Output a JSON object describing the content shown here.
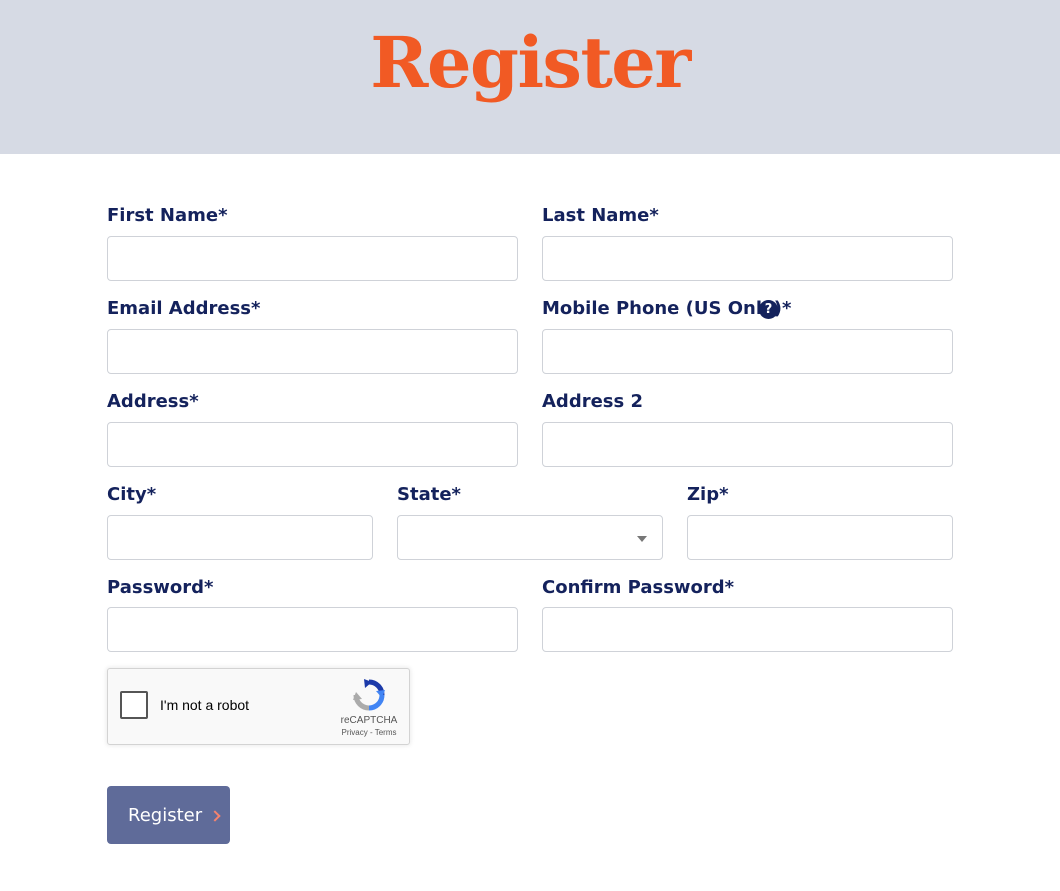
{
  "header": {
    "title": "Register"
  },
  "form": {
    "first_name": {
      "label": "First Name*",
      "value": "",
      "placeholder": ""
    },
    "last_name": {
      "label": "Last Name*",
      "value": "",
      "placeholder": ""
    },
    "email": {
      "label": "Email Address*",
      "value": "",
      "placeholder": ""
    },
    "mobile_phone": {
      "label": "Mobile Phone (US Only)*",
      "value": "",
      "placeholder": "",
      "help_icon": "question-circle-icon",
      "help_glyph": "?"
    },
    "address": {
      "label": "Address*",
      "value": "",
      "placeholder": ""
    },
    "address2": {
      "label": "Address 2",
      "value": "",
      "placeholder": ""
    },
    "city": {
      "label": "City*",
      "value": "",
      "placeholder": ""
    },
    "state": {
      "label": "State*",
      "selected": ""
    },
    "zip": {
      "label": "Zip*",
      "value": "",
      "placeholder": ""
    },
    "password": {
      "label": "Password*",
      "value": "",
      "placeholder": ""
    },
    "confirm_password": {
      "label": "Confirm Password*",
      "value": "",
      "placeholder": ""
    }
  },
  "captcha": {
    "label": "I'm not a robot",
    "brand": "reCAPTCHA",
    "privacy": "Privacy",
    "separator": " - ",
    "terms": "Terms",
    "checked": false
  },
  "submit": {
    "label": "Register",
    "icon": "chevron-right-icon"
  },
  "colors": {
    "header_bg": "#d6dae4",
    "title": "#f15a24",
    "label": "#14225c",
    "button_bg": "#5f6b99",
    "button_chevron": "#f4836e"
  }
}
